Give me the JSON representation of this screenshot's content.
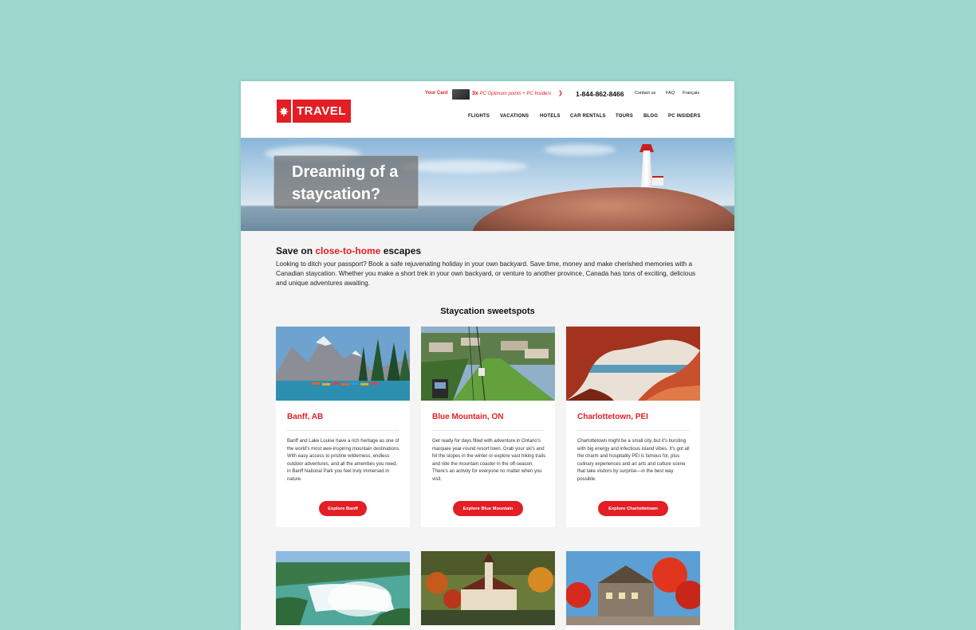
{
  "header": {
    "logo_text": "TRAVEL",
    "your_card_label": "Your Card",
    "points_multiplier": "3x",
    "points_text": "PC Optimum points + PC Insiders",
    "phone": "1-844-862-8466",
    "contact_label": "Contact us",
    "faq_label": "FAQ",
    "language_label": "Français",
    "nav": [
      "FLIGHTS",
      "VACATIONS",
      "HOTELS",
      "CAR RENTALS",
      "TOURS",
      "BLOG",
      "PC INSIDERS"
    ]
  },
  "hero": {
    "line1": "Dreaming of a",
    "line2": "staycation?"
  },
  "intro": {
    "title_pre": "Save on ",
    "title_highlight": "close-to-home",
    "title_post": " escapes",
    "body": "Looking to ditch your passport? Book a safe rejuvenating holiday in your own backyard. Save time, money and make cherished memories with a Canadian staycation. Whether you make a short trek in your own backyard, or venture to another province, Canada has tons of exciting, delicious and unique adventures awaiting."
  },
  "section_title": "Staycation sweetspots",
  "cards": [
    {
      "title": "Banff, AB",
      "text": "Banff and Lake Louise have a rich heritage as one of the world's most awe-inspiring mountain destinations. With easy access to pristine wilderness, endless outdoor adventures, and all the amenities you need, in Banff National Park you feel truly immersed in nature.",
      "button": "Explore Banff"
    },
    {
      "title": "Blue Mountain, ON",
      "text": "Get ready for days filled with adventure in Ontario's marquee year-round resort town. Grab your ski's and hit the slopes in the winter or explore vast hiking trails and ride the mountain coaster in the off-season. There's an activity for everyone no matter when you visit.",
      "button": "Explore Blue Mountain"
    },
    {
      "title": "Charlottetown, PEI",
      "text": "Charlottetown might be a small city, but it's bursting with big energy and infectious island vibes. It's got all the charm and hospitality PEI is famous for, plus culinary experiences and an arts and culture scene that take visitors by surprise—in the best way possible.",
      "button": "Explore Charlottetown"
    }
  ],
  "colors": {
    "brand_red": "#e31e24",
    "backdrop": "#9dd8cf"
  }
}
